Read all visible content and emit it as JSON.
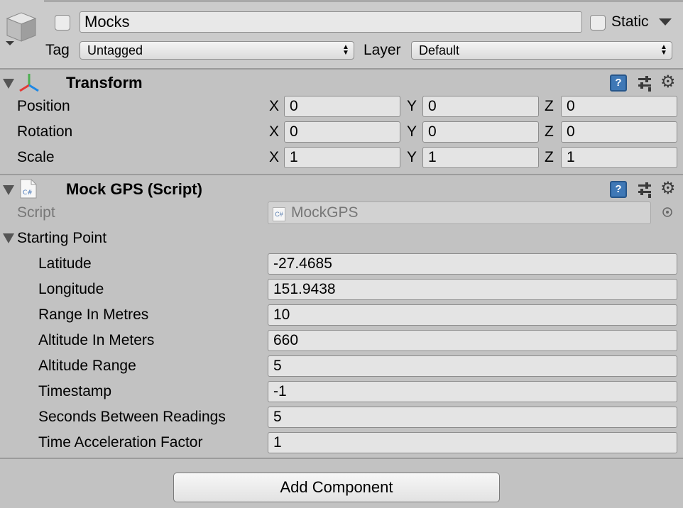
{
  "header": {
    "object_name": "Mocks",
    "static_label": "Static",
    "tag_label": "Tag",
    "tag_value": "Untagged",
    "layer_label": "Layer",
    "layer_value": "Default"
  },
  "transform": {
    "title": "Transform",
    "rows": [
      {
        "label": "Position",
        "x": "0",
        "y": "0",
        "z": "0"
      },
      {
        "label": "Rotation",
        "x": "0",
        "y": "0",
        "z": "0"
      },
      {
        "label": "Scale",
        "x": "1",
        "y": "1",
        "z": "1"
      }
    ],
    "axis_x": "X",
    "axis_y": "Y",
    "axis_z": "Z"
  },
  "mock_gps": {
    "title": "Mock GPS (Script)",
    "script_label": "Script",
    "script_value": "MockGPS",
    "script_badge": "C#",
    "starting_point_label": "Starting Point",
    "fields": [
      {
        "label": "Latitude",
        "value": "-27.4685"
      },
      {
        "label": "Longitude",
        "value": "151.9438"
      },
      {
        "label": "Range In Metres",
        "value": "10"
      },
      {
        "label": "Altitude In Meters",
        "value": "660"
      },
      {
        "label": "Altitude Range",
        "value": "5"
      },
      {
        "label": "Timestamp",
        "value": "-1"
      },
      {
        "label": "Seconds Between Readings",
        "value": "5"
      },
      {
        "label": "Time Acceleration Factor",
        "value": "1"
      }
    ]
  },
  "help_glyph": "?",
  "add_component_label": "Add Component",
  "colors": {
    "panel_bg": "#c2c2c2",
    "header_bg": "#cbcbcb",
    "help_icon_blue": "#3f78b6"
  }
}
